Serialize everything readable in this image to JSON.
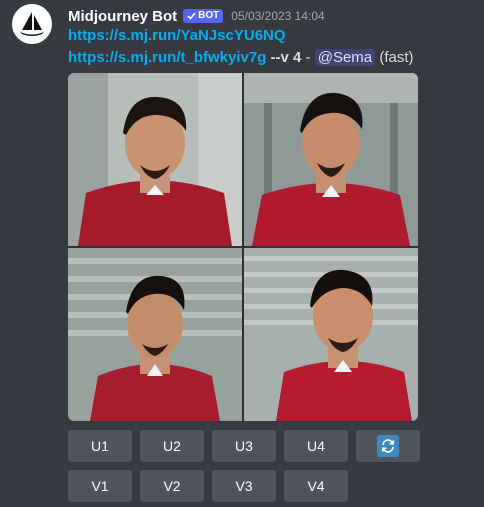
{
  "message": {
    "author": "Midjourney Bot",
    "bot_tag": "BOT",
    "timestamp": "05/03/2023 14:04",
    "link1": "https://s.mj.run/YaNJscYU6NQ",
    "link2": "https://s.mj.run/t_bfwkyiv7g",
    "version_flag": "--v 4",
    "separator": " - ",
    "mention": "@Sema",
    "mode": "(fast)"
  },
  "upscale_buttons": [
    "U1",
    "U2",
    "U3",
    "U4"
  ],
  "variation_buttons": [
    "V1",
    "V2",
    "V3",
    "V4"
  ],
  "icons": {
    "avatar": "midjourney-sailboat-logo",
    "verified": "checkmark-icon",
    "reroll": "refresh-icon"
  },
  "colors": {
    "background": "#36393f",
    "link": "#00aff4",
    "bot_tag": "#5865f2",
    "button": "#4f545c",
    "reroll": "#3b88c3"
  }
}
